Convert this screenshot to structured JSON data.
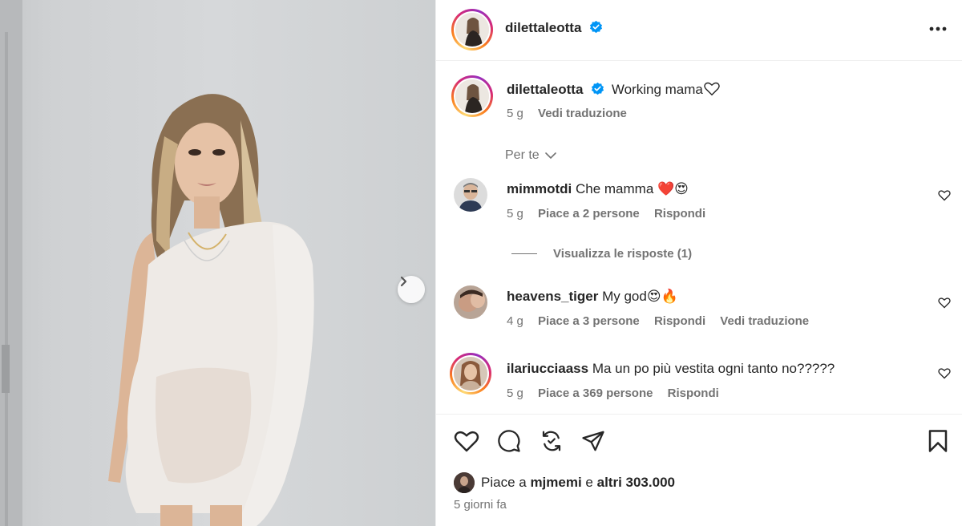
{
  "post": {
    "username": "dilettaleotta",
    "caption": "Working mama",
    "caption_time": "5 g",
    "caption_translate": "Vedi traduzione"
  },
  "icons": {
    "more": "more-options-icon",
    "verified": "verified-badge-icon",
    "next": "chevron-right-icon",
    "heart": "heart-icon",
    "comment": "comment-icon",
    "repost": "repost-icon",
    "share": "send-icon",
    "save": "bookmark-icon"
  },
  "filter": {
    "label": "Per te"
  },
  "comments": [
    {
      "username": "mimmotdi",
      "text": "Che mamma ❤️😍",
      "time": "5 g",
      "likes": "Piace a 2 persone",
      "reply": "Rispondi",
      "translate": ""
    },
    {
      "username": "heavens_tiger",
      "text": "My god😍🔥",
      "time": "4 g",
      "likes": "Piace a 3 persone",
      "reply": "Rispondi",
      "translate": "Vedi traduzione"
    },
    {
      "username": "ilariucciaass",
      "text": "Ma un po più vestita ogni tanto no?????",
      "time": "5 g",
      "likes": "Piace a 369 persone",
      "reply": "Rispondi",
      "translate": ""
    }
  ],
  "view_replies": "Visualizza le risposte (1)",
  "likes_summary": {
    "prefix": "Piace a",
    "user": "mjmemi",
    "middle": "e",
    "others": "altri 303.000"
  },
  "date": "5 giorni fa",
  "colors": {
    "text": "#262626",
    "secondary": "#737373",
    "verified": "#0095f6",
    "heart_red": "#ed1c24",
    "divider": "#efefef"
  }
}
